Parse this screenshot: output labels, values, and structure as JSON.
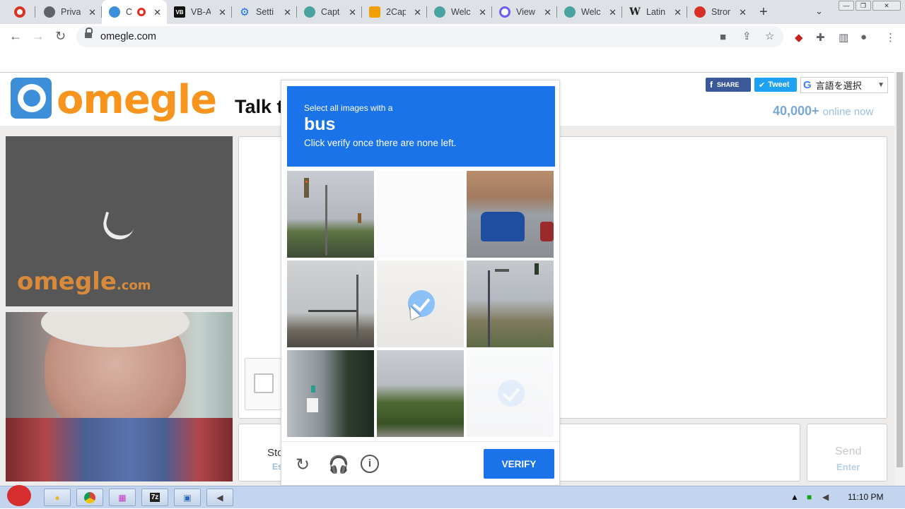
{
  "browser": {
    "tabs": [
      {
        "title": "",
        "icon": "record-icon",
        "color": "#d93025"
      },
      {
        "title": "Priva",
        "icon": "globe-icon",
        "color": "#5f6368"
      },
      {
        "title": "C",
        "icon": "omegle-icon",
        "color": "#3d8fd9",
        "active": true
      },
      {
        "title": "VB-A",
        "icon": "vb-icon",
        "color": "#111111"
      },
      {
        "title": "Setti",
        "icon": "gear-icon",
        "color": "#1a73e8"
      },
      {
        "title": "Capt",
        "icon": "capt-icon",
        "color": "#4aa3a0"
      },
      {
        "title": "2Cap",
        "icon": "twocap-icon",
        "color": "#f29f05"
      },
      {
        "title": "Welc",
        "icon": "capt-icon",
        "color": "#4aa3a0"
      },
      {
        "title": "View",
        "icon": "view-icon",
        "color": "#6b5cf6"
      },
      {
        "title": "Welc",
        "icon": "capt-icon",
        "color": "#4aa3a0"
      },
      {
        "title": "Latin",
        "icon": "wikipedia-icon",
        "color": "#222222"
      },
      {
        "title": "Stror",
        "icon": "stror-icon",
        "color": "#d93025"
      }
    ],
    "new_tab": "+",
    "url": "omegle.com"
  },
  "header": {
    "logo_text": "omegle",
    "tagline": "Talk t",
    "share_label": "SHARE",
    "tweet_label": "Tweet",
    "language_label": "言語を選択",
    "online_count": "40,000+",
    "online_text": "online now"
  },
  "video": {
    "watermark": "omegle",
    "watermark_suffix": ".com"
  },
  "controls": {
    "stop_label": "Sto",
    "stop_key": "Es",
    "send_label": "Send",
    "send_key": "Enter"
  },
  "captcha": {
    "line1": "Select all images with a",
    "target": "bus",
    "line3": "Click verify once there are none left.",
    "verify_label": "VERIFY",
    "tiles": [
      {
        "scene": "traffic-light",
        "selected": false
      },
      {
        "scene": "blank",
        "selected": true
      },
      {
        "scene": "blue-car",
        "selected": false
      },
      {
        "scene": "street-pole",
        "selected": false
      },
      {
        "scene": "selected-road",
        "selected": true
      },
      {
        "scene": "traffic-signal",
        "selected": false
      },
      {
        "scene": "building-sign",
        "selected": false
      },
      {
        "scene": "palm-trees",
        "selected": false
      },
      {
        "scene": "faded",
        "selected": true
      }
    ]
  },
  "taskbar": {
    "clock": "11:10 PM"
  }
}
